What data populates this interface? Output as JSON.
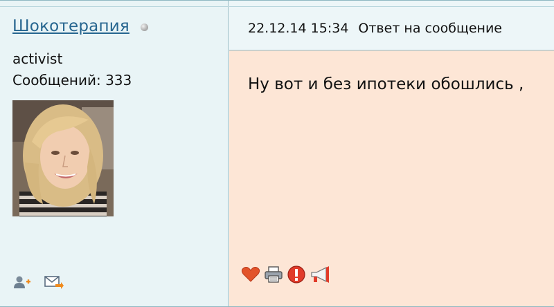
{
  "user": {
    "name": "Шокотерапия",
    "rank": "activist",
    "posts": "Сообщений: 333"
  },
  "post": {
    "datetime": "22.12.14 15:34",
    "reply_label": "Ответ на сообщение",
    "text": "Ну вот и без ипотеки обошлись ,"
  },
  "icons": {
    "status": "offline-status-icon",
    "add_friend": "add-friend-icon",
    "send_message": "send-message-icon",
    "like": "heart-icon",
    "print": "printer-icon",
    "report": "warning-icon",
    "announce": "megaphone-icon"
  },
  "colors": {
    "link": "#26658f",
    "left_panel": "#e9f4f6",
    "message_bg": "#fde6d6",
    "border": "#8fb8c2"
  }
}
